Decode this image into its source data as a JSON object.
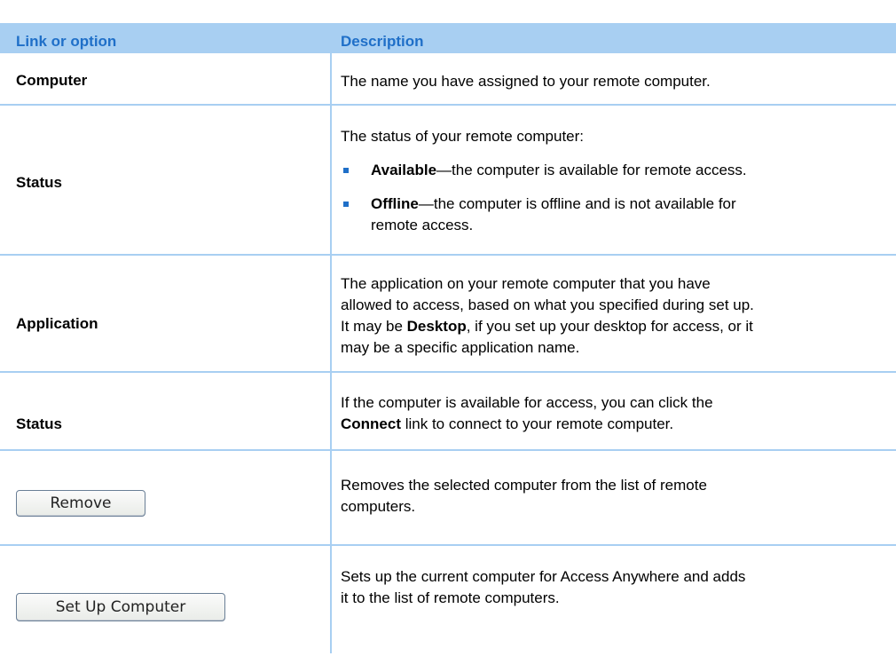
{
  "header": {
    "col1": "Link or option",
    "col2": "Description"
  },
  "rows": {
    "computer": {
      "label": "Computer",
      "desc": "The name you have assigned to your remote computer."
    },
    "status1": {
      "label": "Status",
      "intro": "The status of your remote computer:",
      "b1_bold": "Available",
      "b1_text": "—the computer is available for remote access.",
      "b2_bold": "Offline",
      "b2_line1": "—the computer is offline and is not available for",
      "b2_line2": "remote access."
    },
    "application": {
      "label": "Application",
      "line1": "The application on your remote computer that you have",
      "line2": "allowed to access, based on what you specified during set up.",
      "line3_pre": "It may be ",
      "line3_bold": "Desktop",
      "line3_post": ", if you set up your desktop for access, or it",
      "line4": "may be a specific application name."
    },
    "status2": {
      "label": "Status",
      "line1": "If the computer is available for access, you can click the",
      "line2_bold": "Connect",
      "line2_post": " link to connect to your remote computer."
    },
    "remove": {
      "button": "Remove",
      "line1": "Removes the selected computer from the list of remote",
      "line2": "computers."
    },
    "setup": {
      "button": "Set Up Computer",
      "line1": "Sets up the current computer for Access Anywhere and adds",
      "line2": "it to the list of remote computers."
    }
  },
  "colors": {
    "header_bg": "#a8cff2",
    "header_text": "#1f6fc8",
    "bullet": "#1f6fc8"
  }
}
